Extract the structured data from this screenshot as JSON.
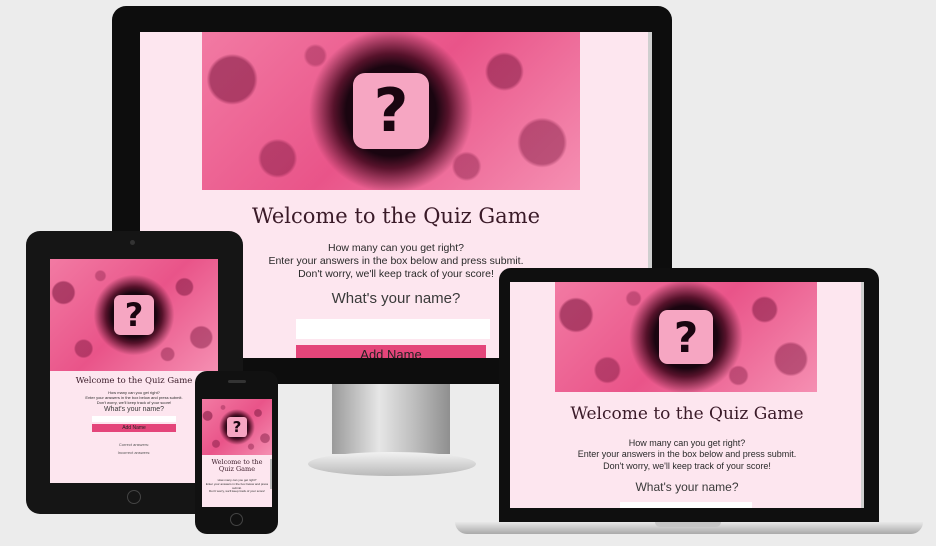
{
  "quiz": {
    "title": "Welcome to the Quiz Game",
    "intro_line1": "How many can you get right?",
    "intro_line2": "Enter your answers in the box below and press submit.",
    "intro_line3": "Don't worry, we'll keep track of your score!",
    "name_label": "What's your name?",
    "name_placeholder": "",
    "add_name_button": "Add Name",
    "correct_answers_label": "Correct answers:",
    "incorrect_answers_label": "Incorrect answers:",
    "hero_icon": "question-mark-icon",
    "phone_title_line1": "Welcome to the",
    "phone_title_line2": "Quiz Game"
  },
  "colors": {
    "screen_bg": "#fde6ef",
    "accent": "#e4457a",
    "hero_pink": "#e95489",
    "device_frame": "#111111"
  }
}
